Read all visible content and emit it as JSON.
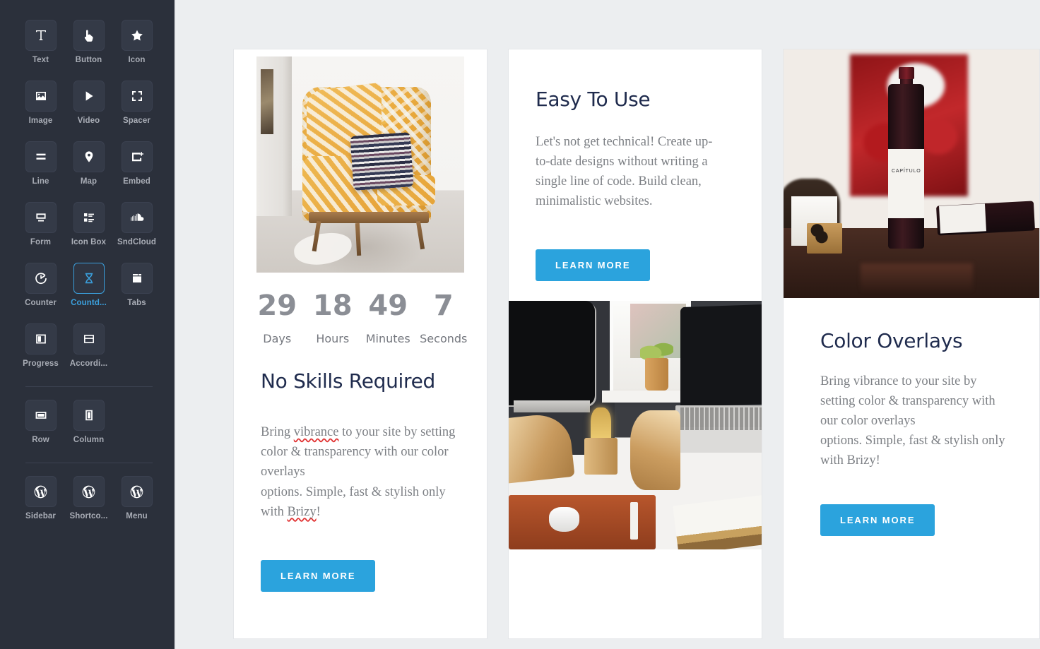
{
  "sidebar": {
    "groups": [
      {
        "items": [
          {
            "label": "Text",
            "icon": "text-icon",
            "selected": false
          },
          {
            "label": "Button",
            "icon": "button-icon",
            "selected": false
          },
          {
            "label": "Icon",
            "icon": "star-icon",
            "selected": false
          },
          {
            "label": "Image",
            "icon": "image-icon",
            "selected": false
          },
          {
            "label": "Video",
            "icon": "video-play-icon",
            "selected": false
          },
          {
            "label": "Spacer",
            "icon": "spacer-icon",
            "selected": false
          },
          {
            "label": "Line",
            "icon": "line-icon",
            "selected": false
          },
          {
            "label": "Map",
            "icon": "map-pin-icon",
            "selected": false
          },
          {
            "label": "Embed",
            "icon": "embed-icon",
            "selected": false
          },
          {
            "label": "Form",
            "icon": "form-icon",
            "selected": false
          },
          {
            "label": "Icon Box",
            "icon": "icon-box-icon",
            "selected": false
          },
          {
            "label": "SndCloud",
            "icon": "soundcloud-icon",
            "selected": false
          },
          {
            "label": "Counter",
            "icon": "counter-icon",
            "selected": false
          },
          {
            "label": "Countd...",
            "icon": "hourglass-icon",
            "selected": true
          },
          {
            "label": "Tabs",
            "icon": "tabs-icon",
            "selected": false
          }
        ]
      },
      {
        "items": [
          {
            "label": "Progress",
            "icon": "progress-icon",
            "selected": false
          },
          {
            "label": "Accordi...",
            "icon": "accordion-icon",
            "selected": false
          }
        ]
      },
      {
        "items": [
          {
            "label": "Row",
            "icon": "row-icon",
            "selected": false
          },
          {
            "label": "Column",
            "icon": "column-icon",
            "selected": false
          }
        ]
      },
      {
        "items": [
          {
            "label": "Sidebar",
            "icon": "wordpress-icon",
            "selected": false
          },
          {
            "label": "Shortco...",
            "icon": "wordpress-icon",
            "selected": false
          },
          {
            "label": "Menu",
            "icon": "wordpress-icon",
            "selected": false
          }
        ]
      }
    ]
  },
  "colors": {
    "sidebar_bg": "#2b303b",
    "tile_bg": "#343a47",
    "accent": "#3ba0dd",
    "button_blue": "#2ba3dd",
    "heading_navy": "#1f2b4d",
    "body_gray": "#7d8085",
    "canvas_bg": "#eceef0",
    "card_bg": "#ffffff",
    "countdown_number": "#8b8e95"
  },
  "cards": {
    "left": {
      "image_alt": "orange floral patterned armchair with woven pillow",
      "countdown": [
        {
          "value": "29",
          "label": "Days"
        },
        {
          "value": "18",
          "label": "Hours"
        },
        {
          "value": "49",
          "label": "Minutes"
        },
        {
          "value": "7",
          "label": "Seconds"
        }
      ],
      "heading": "No Skills Required",
      "body_parts": [
        {
          "text": "Bring ",
          "misspelled": false
        },
        {
          "text": "vibrance",
          "misspelled": true
        },
        {
          "text": " to your site by setting color & transparency with our color overlays",
          "misspelled": false
        },
        {
          "text": "\noptions. Simple, fast & stylish only with ",
          "misspelled": false
        },
        {
          "text": "Brizy",
          "misspelled": true
        },
        {
          "text": "!",
          "misspelled": false
        }
      ],
      "body_line1": "Bring ",
      "body_word1": "vibrance",
      "body_line2": " to your site by setting color & transparency with our color overlays",
      "body_line3": "options. Simple, fast & stylish only with ",
      "body_word2": "Brizy",
      "body_line4": "!",
      "button_label": "LEARN MORE"
    },
    "middle": {
      "heading": "Easy To Use",
      "body": "Let's not get technical! Create up-to-date designs without writing a single line of code. Build clean, minimalistic websites.",
      "button_label": "LEARN MORE",
      "image_alt": "desk workspace with monitor, laptop, wooden stands, lamp and mouse on leather pad"
    },
    "right": {
      "image_alt": "two CAPITULO red wine bottles on a dark table with red abstract painting",
      "wine_label": "CAPÍTULO",
      "heading": "Color Overlays",
      "body_line1": "Bring vibrance to your site by setting color & transparency with our color overlays",
      "body_line2": "options. Simple, fast & stylish only with Brizy!",
      "button_label": "LEARN MORE"
    }
  }
}
